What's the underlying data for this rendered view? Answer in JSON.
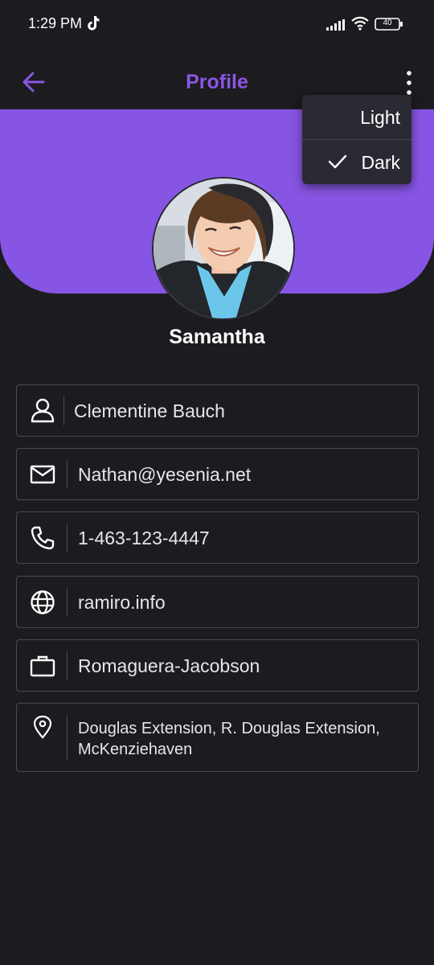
{
  "status_bar": {
    "time": "1:29 PM",
    "battery": "40"
  },
  "app_bar": {
    "title": "Profile"
  },
  "menu": {
    "items": [
      {
        "label": "Light",
        "selected": false
      },
      {
        "label": "Dark",
        "selected": true
      }
    ]
  },
  "profile": {
    "name": "Samantha",
    "fields": {
      "full_name": "Clementine Bauch",
      "email": "Nathan@yesenia.net",
      "phone": "1-463-123-4447",
      "website": "ramiro.info",
      "company": "Romaguera-Jacobson",
      "address": "Douglas Extension, R. Douglas Extension, McKenziehaven"
    }
  },
  "icons": {
    "back": "arrow-left-icon",
    "more": "more-vert-icon",
    "full_name": "person-icon",
    "email": "mail-icon",
    "phone": "phone-icon",
    "website": "globe-icon",
    "company": "briefcase-icon",
    "address": "location-pin-icon"
  },
  "colors": {
    "accent": "#8655e3",
    "title": "#8a56e6",
    "background": "#1c1b1f",
    "menu": "#2b2a33"
  }
}
